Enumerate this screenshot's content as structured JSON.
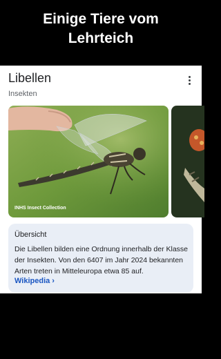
{
  "headline": {
    "line1": "Einige Tiere vom",
    "line2": "Lehrteich"
  },
  "card": {
    "title": "Libellen",
    "subtitle": "Insekten",
    "menu_icon": "more-vert-icon",
    "image_credit": "INHS Insect Collection",
    "overview": {
      "heading": "Übersicht",
      "text": "Die Libellen bilden eine Ordnung innerhalb der Klasse der Insekten. Von den 6407 im Jahr 2024 bekannten Arten treten in Mitteleuropa etwa 85 auf.",
      "link_label": "Wikipedia",
      "link_chevron": "›"
    }
  },
  "colors": {
    "background": "#000000",
    "card": "#ffffff",
    "overview_bg": "#e9eef6",
    "link": "#1a56c2"
  }
}
